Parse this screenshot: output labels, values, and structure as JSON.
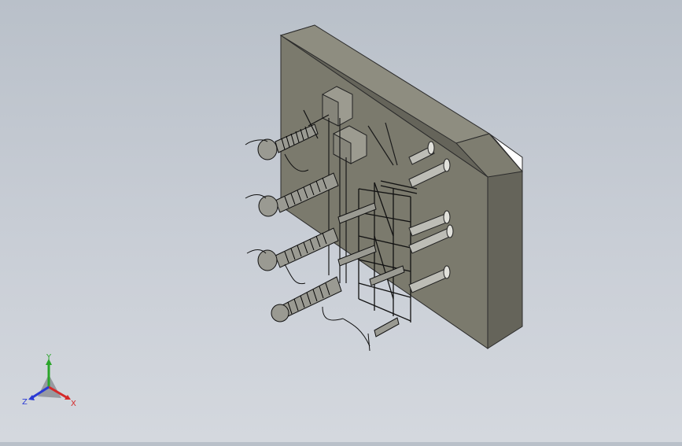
{
  "viewport": {
    "background_top": "#b9c0c9",
    "background_bottom": "#d4d8de",
    "model_color": "#7b7a6d",
    "model_edge_color": "#2b2b2b",
    "model_side_color": "#65645a",
    "model_top_color": "#8e8d80"
  },
  "triad": {
    "x_label": "X",
    "y_label": "Y",
    "z_label": "Z",
    "x_color": "#d42a2a",
    "y_color": "#2aa52a",
    "z_color": "#2a3ad4"
  }
}
